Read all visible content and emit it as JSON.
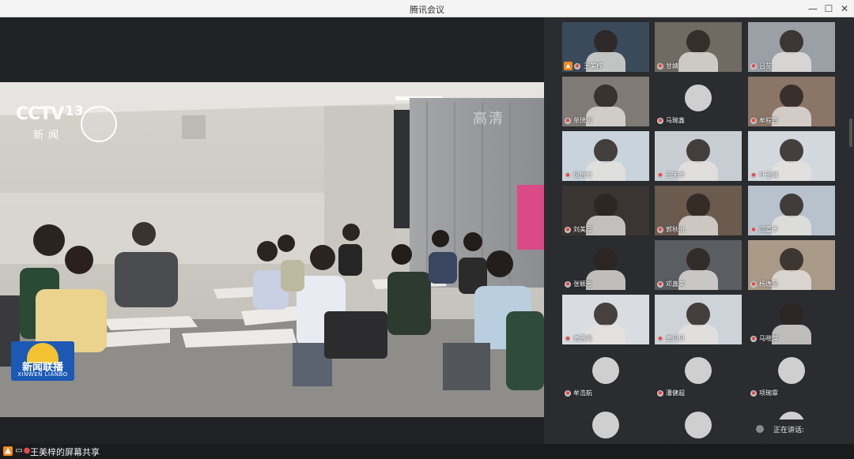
{
  "window": {
    "title": "腾讯会议",
    "minimize_glyph": "—",
    "maximize_glyph": "☐",
    "close_glyph": "✕"
  },
  "screen_share": {
    "channel_logo": "CCTV",
    "channel_number": "13",
    "channel_sub": "新闻",
    "hd_mark": "高清",
    "program_title": "新闻联播",
    "program_sub": "XINWEN LIANBO",
    "share_label": "王美梓的屏幕共享"
  },
  "participants": [
    {
      "name": "王美梓",
      "host": true
    },
    {
      "name": "甘婧"
    },
    {
      "name": "吕花"
    },
    {
      "name": "单琇润"
    },
    {
      "name": "马琬鑫"
    },
    {
      "name": "牟程雪"
    },
    {
      "name": "倪怡竹"
    },
    {
      "name": "王天齐"
    },
    {
      "name": "叶玉婧"
    },
    {
      "name": "刘美蕊"
    },
    {
      "name": "郭秋治"
    },
    {
      "name": "闫嘉予"
    },
    {
      "name": "张颖芳"
    },
    {
      "name": "邓鑫荣"
    },
    {
      "name": "杨逸菲"
    },
    {
      "name": "姜秀英"
    },
    {
      "name": "姜贝贝"
    },
    {
      "name": "马晓萍"
    },
    {
      "name": "牟浩航"
    },
    {
      "name": "潘健超"
    },
    {
      "name": "项琬霏"
    },
    {
      "name": "赵小可"
    },
    {
      "name": "朴敏靖"
    },
    {
      "name": "赵晴"
    }
  ],
  "speaking_indicator": "正在讲话:",
  "colors": {
    "host_badge": "#f28a1e",
    "news_badge": "#1b59b4"
  }
}
